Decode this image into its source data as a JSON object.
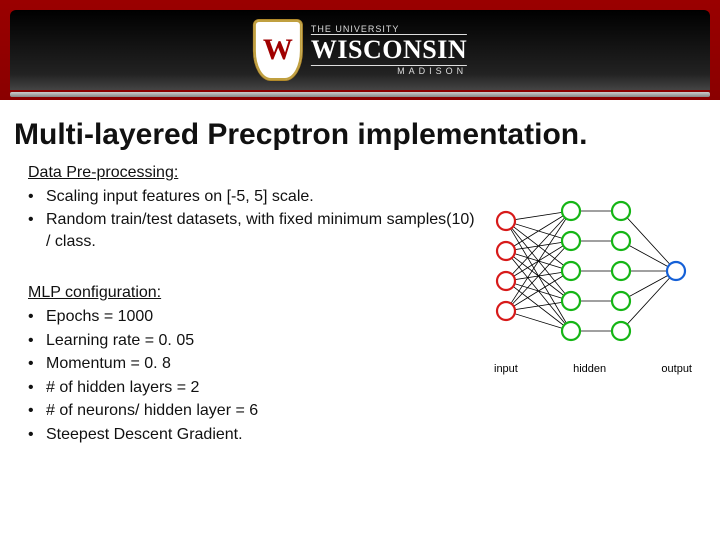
{
  "header": {
    "org_line1": "THE UNIVERSITY",
    "org_name": "WISCONSIN",
    "org_line3": "MADISON",
    "crest_letter": "W"
  },
  "title": "Multi-layered Precptron implementation.",
  "sections": {
    "preproc": {
      "heading": "Data Pre-processing:",
      "items": [
        "Scaling input features on [-5, 5] scale.",
        "Random train/test datasets, with fixed minimum samples(10) / class."
      ]
    },
    "mlp": {
      "heading": "MLP configuration:",
      "items": [
        "Epochs = 1000",
        "Learning rate = 0. 05",
        "Momentum =  0. 8",
        "# of hidden layers = 2",
        "# of neurons/ hidden layer = 6",
        "Steepest Descent Gradient."
      ]
    }
  },
  "diagram": {
    "labels": {
      "input": "input",
      "hidden": "hidden",
      "output": "output"
    },
    "colors": {
      "input": "#d71a1a",
      "hidden": "#15b515",
      "output": "#1560d7"
    },
    "counts": {
      "input": 4,
      "hidden1": 5,
      "hidden2": 5,
      "output": 1
    }
  }
}
